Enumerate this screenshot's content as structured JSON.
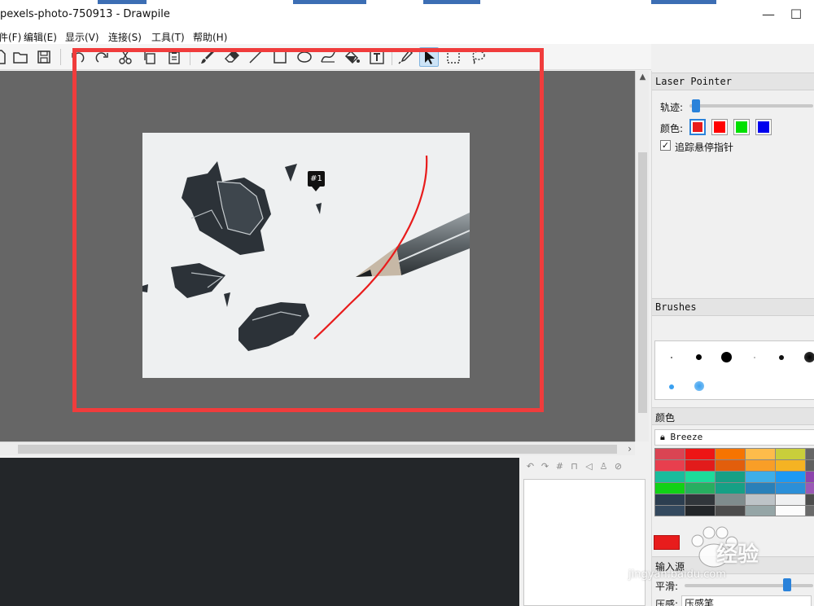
{
  "window": {
    "title": "pexels-photo-750913 - Drawpile"
  },
  "window_controls": {
    "minimize": "—",
    "maximize": "☐"
  },
  "menu": [
    "文件(F)",
    "编辑(E)",
    "显示(V)",
    "连接(S)",
    "工具(T)",
    "帮助(H)"
  ],
  "canvas": {
    "user_marker": "#1"
  },
  "laser_pointer": {
    "title": "Laser Pointer",
    "trail_label": "轨迹:",
    "trail_value": 0.02,
    "color_label": "颜色:",
    "colors": [
      "#e81c1c",
      "#ff0000",
      "#00e000",
      "#0000ee"
    ],
    "track_hover_label": "追踪悬停指针",
    "track_hover_checked": true
  },
  "brushes": {
    "title": "Brushes"
  },
  "colors_panel": {
    "title": "颜色",
    "palette_name": "Breeze",
    "palette": [
      "#da4453",
      "#ed1515",
      "#f67400",
      "#fdbc4b",
      "#c9ce3b",
      "#666666",
      "#e83f4e",
      "#e21b1b",
      "#e25e0c",
      "#f99e27",
      "#f5b323",
      "#606060",
      "#1abc9c",
      "#1cdc9a",
      "#16a085",
      "#3daee9",
      "#1d99f3",
      "#8e44ad",
      "#11d116",
      "#27ae60",
      "#16a085",
      "#2980b9",
      "#2b8fd8",
      "#9b59b6",
      "#2c3e50",
      "#31363b",
      "#7f8c8d",
      "#bdc3c7",
      "#eff0f1",
      "#4d4d4d",
      "#34495e",
      "#232629",
      "#4d4d4d",
      "#95a5a6",
      "#fcfcfc",
      "#6a6a6a"
    ],
    "current_color": "#e81c1c"
  },
  "input_panel": {
    "title": "输入源",
    "smoothing_label": "平滑:",
    "smoothing_value": 0.82,
    "pressure_label": "压感:",
    "pressure_value": "压感笔"
  },
  "watermark": {
    "text": "经验",
    "url": "jingyan.baidu.com"
  }
}
